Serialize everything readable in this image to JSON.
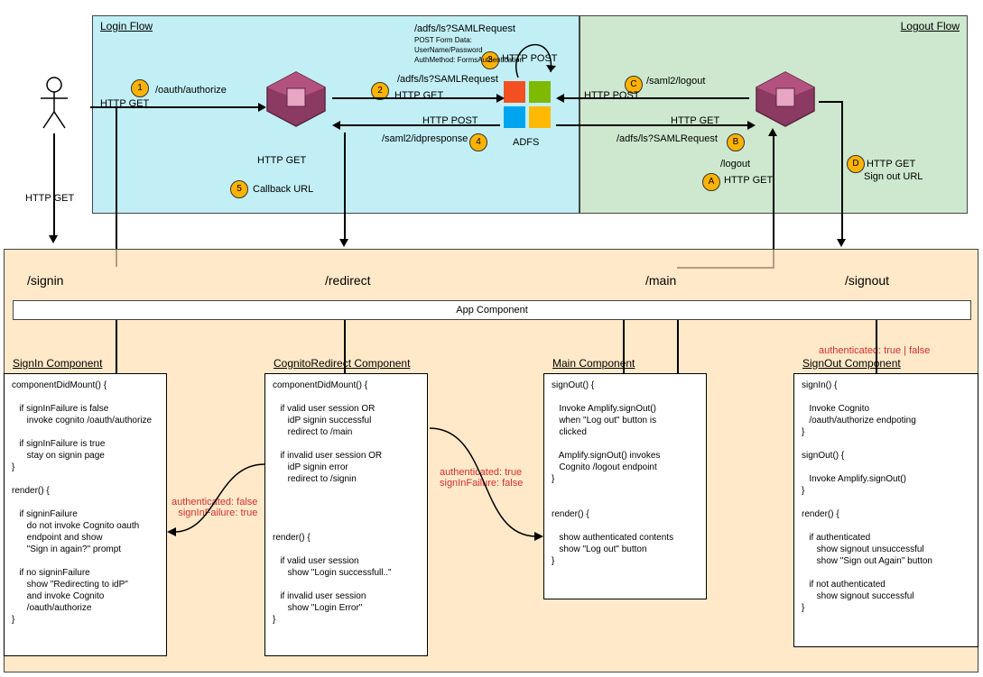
{
  "panels": {
    "login_title": "Login Flow",
    "logout_title": "Logout Flow"
  },
  "actor": {
    "caption": "HTTP GET"
  },
  "steps": {
    "s1": "1",
    "s2": "2",
    "s3": "3",
    "s4": "4",
    "s5": "5",
    "sA": "A",
    "sB": "B",
    "sC": "C",
    "sD": "D"
  },
  "labels": {
    "oauth_authorize": "/oauth/authorize",
    "http_get": "HTTP GET",
    "http_post": "HTTP POST",
    "adfs_samlrequest": "/adfs/ls?SAMLRequest",
    "adfs_samlrequest_top": "/adfs/ls?SAMLRequest",
    "post_form": "POST Form Data:",
    "user_pass": "UserName/Password",
    "auth_method": "AuthMethod: FormsAuthentication",
    "saml_idpresponse": "/saml2/idpresponse",
    "callback_url": "Callback URL",
    "saml_logout": "/saml2/logout",
    "logout": "/logout",
    "signout_url": "Sign out URL",
    "adfs": "ADFS"
  },
  "routes": {
    "signin": "/signin",
    "redirect": "/redirect",
    "main": "/main",
    "signout": "/signout"
  },
  "app_bar": "App Component",
  "components": {
    "signin_title": "SignIn Component",
    "signin_body": "componentDidMount() {\n\n   if signInFailure is false\n      invoke cognito /oauth/authorize\n\n   if signInFailure is true\n      stay on signin page\n}\n\nrender() {\n\n   if signinFailure\n      do not invoke Cognito oauth\n      endpoint and show\n      \"Sign in again?\" prompt\n\n   if no signinFailure\n      show \"Redirecting to idP\"\n      and invoke Cognito\n      /oauth/authorize\n}",
    "redirect_title": "CognitoRedirect Component",
    "redirect_body": "componentDidMount() {\n\n   if valid user session OR\n      idP signin successful\n      redirect to /main\n\n   if invalid user session OR\n      idP signin error\n      redirect to /signin\n\n\n\n\nrender() {\n\n   if valid user session\n      show \"Login successfull..\"\n\n   if invalid user session\n      show \"Login Error\"\n}",
    "main_title": "Main  Component",
    "main_body": "signOut() {\n\n   Invoke Amplify.signOut()\n   when \"Log out\" button is\n   clicked\n\n   Amplify.signOut() invokes\n   Cognito /logout endpoint\n}\n\n\nrender() {\n\n   show authenticated contents\n   show \"Log out\" button\n}",
    "signout_title": "SignOut Component",
    "signout_body": "signIn() {\n\n   Invoke Cognito\n   /oauth/authorize endpoting\n}\n\nsignOut() {\n\n   Invoke Amplify.signOut()\n}\n\nrender() {\n\n   if authenticated\n      show signout unsuccessful\n      show \"Sign out Again\" button\n\n   if not authenticated\n      show signout successful\n}"
  },
  "annotations": {
    "auth_false_fail_true": "authenticated: false\nsignInFailure: true",
    "auth_true_fail_false": "authenticated: true\nsignInFailure: false",
    "auth_true_or_false": "authenticated: true | false"
  }
}
